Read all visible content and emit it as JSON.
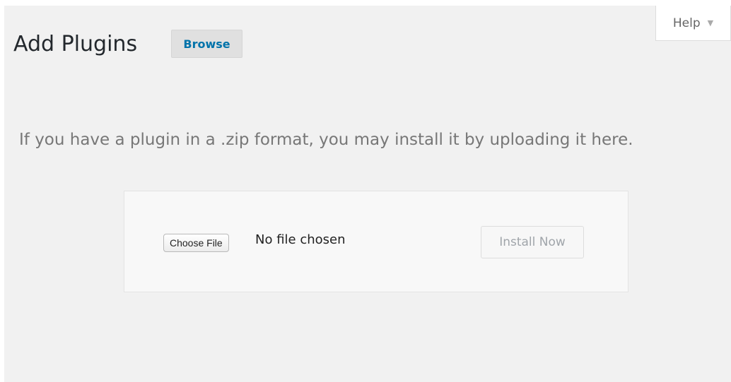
{
  "header": {
    "title": "Add Plugins",
    "browse_label": "Browse",
    "help_label": "Help",
    "help_arrow_icon": "caret-down-icon"
  },
  "upload": {
    "instructions": "If you have a plugin in a .zip format, you may install it by uploading it here.",
    "choose_file_label": "Choose File",
    "file_status": "No file chosen",
    "install_label": "Install Now"
  },
  "colors": {
    "background": "#f1f1f1",
    "link_blue": "#0073aa",
    "muted_text": "#777777",
    "disabled_text": "#a0a5aa"
  }
}
